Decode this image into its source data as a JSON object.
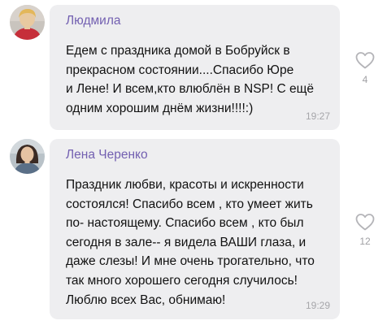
{
  "comments": [
    {
      "author": "Людмила",
      "text": "Едем с праздника домой в Бобруйск в\nпрекрасном состоянии....Спасибо Юре\nи Лене! И всем,кто влюблён в NSP!  С ещё\nодним хорошим днём жизни!!!!:)",
      "time": "19:27",
      "likes": "4",
      "avatar_icon": "user-photo",
      "like_icon": "heart-outline-icon"
    },
    {
      "author": "Лена Черенко",
      "text": "Праздник любви, красоты и искренности\nсостоялся! Спасибо всем , кто умеет жить\nпо- настоящему. Спасибо всем , кто был\nсегодня в зале-- я видела ВАШИ глаза, и\nдаже слезы! И мне очень трогательно, что\nтак много хорошего сегодня случилось!\nЛюблю всех Вас, обнимаю!",
      "time": "19:29",
      "likes": "12",
      "avatar_icon": "user-photo",
      "like_icon": "heart-outline-icon"
    }
  ],
  "colors": {
    "author": "#7360b1",
    "bubble": "#eeeef0",
    "meta": "#a6a6aa"
  }
}
